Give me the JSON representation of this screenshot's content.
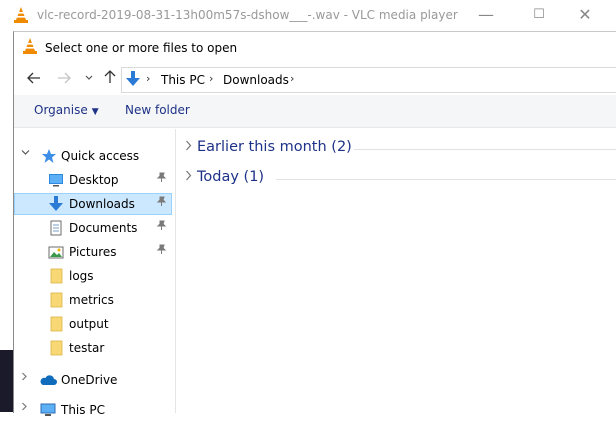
{
  "vlc_window": {
    "title": "vlc-record-2019-08-31-13h00m57s-dshow___-.wav - VLC media player",
    "controls": {
      "minimize": "—",
      "maximize": "☐",
      "close": "✕"
    }
  },
  "dialog": {
    "title": "Select one or more files to open",
    "address": {
      "parts": [
        "This PC",
        "Downloads"
      ]
    },
    "toolbar": {
      "organise": "Organise",
      "new_folder": "New folder"
    },
    "nav": {
      "quick_access": "Quick access",
      "items": [
        {
          "label": "Desktop",
          "icon": "desktop-icon",
          "pinned": true
        },
        {
          "label": "Downloads",
          "icon": "downloads-icon",
          "pinned": true,
          "selected": true
        },
        {
          "label": "Documents",
          "icon": "documents-icon",
          "pinned": true
        },
        {
          "label": "Pictures",
          "icon": "pictures-icon",
          "pinned": true
        },
        {
          "label": "logs",
          "icon": "folder-icon"
        },
        {
          "label": "metrics",
          "icon": "folder-icon"
        },
        {
          "label": "output",
          "icon": "folder-icon"
        },
        {
          "label": "testar",
          "icon": "folder-icon"
        }
      ],
      "onedrive": "OneDrive",
      "this_pc": "This PC"
    },
    "groups": [
      {
        "label": "Earlier this month (2)"
      },
      {
        "label": "Today (1)"
      }
    ]
  },
  "colors": {
    "selection": "#cce8ff",
    "link_text": "#1e3287",
    "vlc_orange": "#f08a00"
  }
}
